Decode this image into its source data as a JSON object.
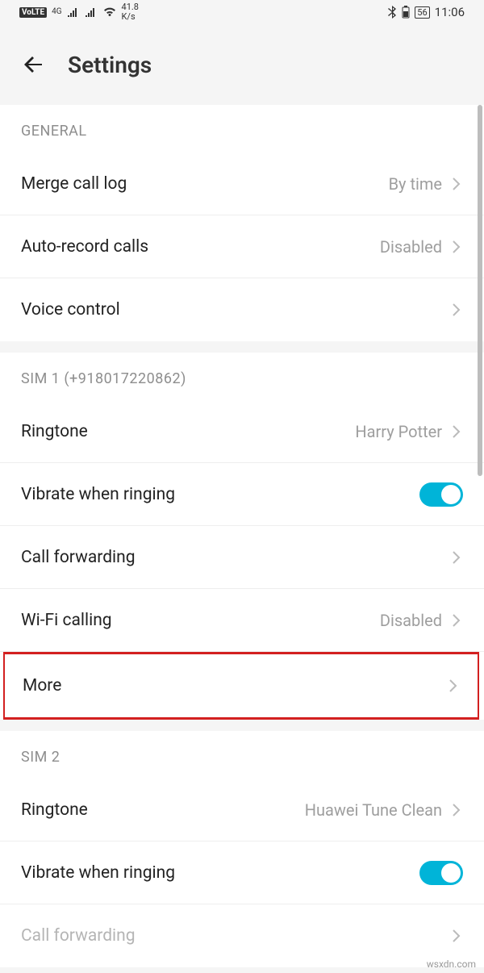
{
  "statusbar": {
    "volte": "VoLTE",
    "network_gen": "4G",
    "speed_top": "41.8",
    "speed_bottom": "K/s",
    "battery": "56",
    "time": "11:06"
  },
  "header": {
    "title": "Settings"
  },
  "sections": {
    "general": {
      "title": "GENERAL",
      "merge_call_log": {
        "label": "Merge call log",
        "value": "By time"
      },
      "auto_record": {
        "label": "Auto-record calls",
        "value": "Disabled"
      },
      "voice_control": {
        "label": "Voice control"
      }
    },
    "sim1": {
      "title": "SIM 1 (+918017220862)",
      "ringtone": {
        "label": "Ringtone",
        "value": "Harry Potter"
      },
      "vibrate": {
        "label": "Vibrate when ringing",
        "on": true
      },
      "call_forwarding": {
        "label": "Call forwarding"
      },
      "wifi_calling": {
        "label": "Wi-Fi calling",
        "value": "Disabled"
      },
      "more": {
        "label": "More"
      }
    },
    "sim2": {
      "title": "SIM 2",
      "ringtone": {
        "label": "Ringtone",
        "value": "Huawei Tune Clean"
      },
      "vibrate": {
        "label": "Vibrate when ringing",
        "on": true
      },
      "call_forwarding": {
        "label": "Call forwarding"
      }
    }
  },
  "watermark": "wsxdn.com"
}
